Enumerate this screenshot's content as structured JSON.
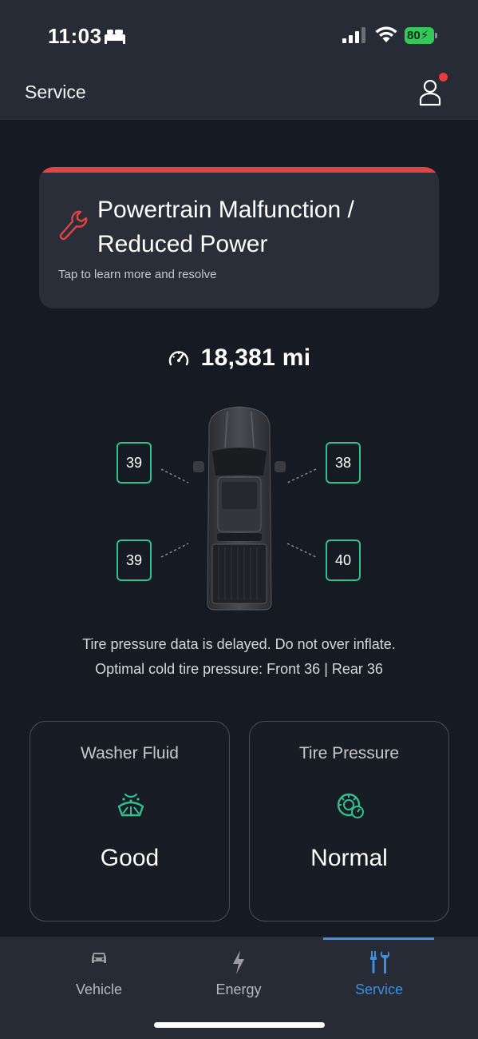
{
  "status_bar": {
    "time": "11:03",
    "battery_percent": "80",
    "icons": [
      "bed-icon",
      "signal-icon",
      "wifi-icon",
      "battery-charging-icon"
    ]
  },
  "header": {
    "title": "Service",
    "profile_icon": "person-icon",
    "has_notification": true
  },
  "alert": {
    "title": "Powertrain Malfunction / Reduced Power",
    "subtitle": "Tap to learn more and resolve",
    "icon": "wrench-icon",
    "accent_color": "#e14444"
  },
  "odometer": {
    "value": "18,381 mi",
    "icon": "speedometer-icon"
  },
  "tires": {
    "front_left": "39",
    "front_right": "38",
    "rear_left": "39",
    "rear_right": "40",
    "border_color": "#2fc18f",
    "note_line1": "Tire pressure data is delayed. Do not over inflate.",
    "note_line2": "Optimal cold tire pressure: Front 36 | Rear 36"
  },
  "cards": [
    {
      "label": "Washer Fluid",
      "value": "Good",
      "icon": "washer-fluid-icon"
    },
    {
      "label": "Tire Pressure",
      "value": "Normal",
      "icon": "tire-pressure-icon"
    }
  ],
  "tabs": [
    {
      "label": "Vehicle",
      "icon": "car-icon",
      "active": false
    },
    {
      "label": "Energy",
      "icon": "lightning-icon",
      "active": false
    },
    {
      "label": "Service",
      "icon": "tools-icon",
      "active": true
    }
  ],
  "colors": {
    "accent_green": "#2fc18f",
    "active_tab": "#3d8fe0",
    "alert_red": "#e14444"
  }
}
